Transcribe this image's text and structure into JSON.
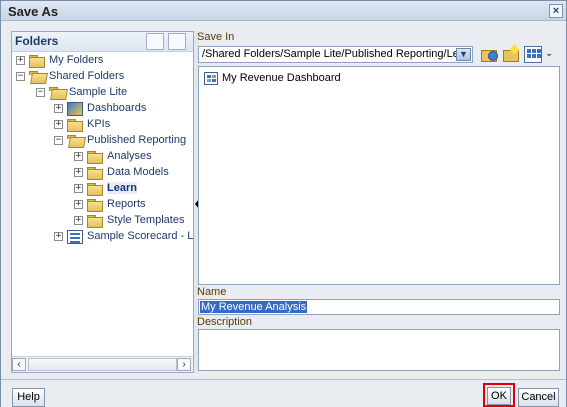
{
  "dialog": {
    "title": "Save As",
    "close_glyph": "×"
  },
  "folders": {
    "title": "Folders",
    "header_icons": [
      "folder-tree-icon",
      "favorites-folder-icon"
    ],
    "tree": [
      {
        "label": "My Folders",
        "expander": "+",
        "icon": "folder-icon"
      },
      {
        "label": "Shared Folders",
        "expander": "−",
        "icon": "open-folder-icon"
      },
      {
        "label": "Sample Lite",
        "expander": "−",
        "icon": "open-folder-icon"
      },
      {
        "label": "Dashboards",
        "expander": "+",
        "icon": "dashboard-folder-icon"
      },
      {
        "label": "KPIs",
        "expander": "+",
        "icon": "folder-icon"
      },
      {
        "label": "Published Reporting",
        "expander": "−",
        "icon": "open-folder-icon"
      },
      {
        "label": "Analyses",
        "expander": "+",
        "icon": "folder-icon"
      },
      {
        "label": "Data Models",
        "expander": "+",
        "icon": "folder-icon"
      },
      {
        "label": "Learn",
        "expander": "+",
        "icon": "folder-icon",
        "selected": true
      },
      {
        "label": "Reports",
        "expander": "+",
        "icon": "folder-icon"
      },
      {
        "label": "Style Templates",
        "expander": "+",
        "icon": "folder-icon"
      },
      {
        "label": "Sample Scorecard - Lit",
        "expander": "+",
        "icon": "scorecard-icon"
      }
    ],
    "scroll_left": "‹",
    "scroll_right": "›"
  },
  "save_in": {
    "label": "Save In",
    "path": "/Shared Folders/Sample Lite/Published Reporting/Lea",
    "dropdown_glyph": "▼",
    "toolbar_icons": [
      "up-folder-icon",
      "new-folder-icon",
      "view-options-icon"
    ],
    "chevron": "⌄"
  },
  "contents": {
    "items": [
      {
        "label": "My Revenue Dashboard",
        "icon": "dashboard-icon"
      }
    ]
  },
  "name": {
    "label": "Name",
    "value": "My Revenue Analysis"
  },
  "description": {
    "label": "Description",
    "value": ""
  },
  "buttons": {
    "help": "Help",
    "ok": "OK",
    "cancel": "Cancel"
  }
}
